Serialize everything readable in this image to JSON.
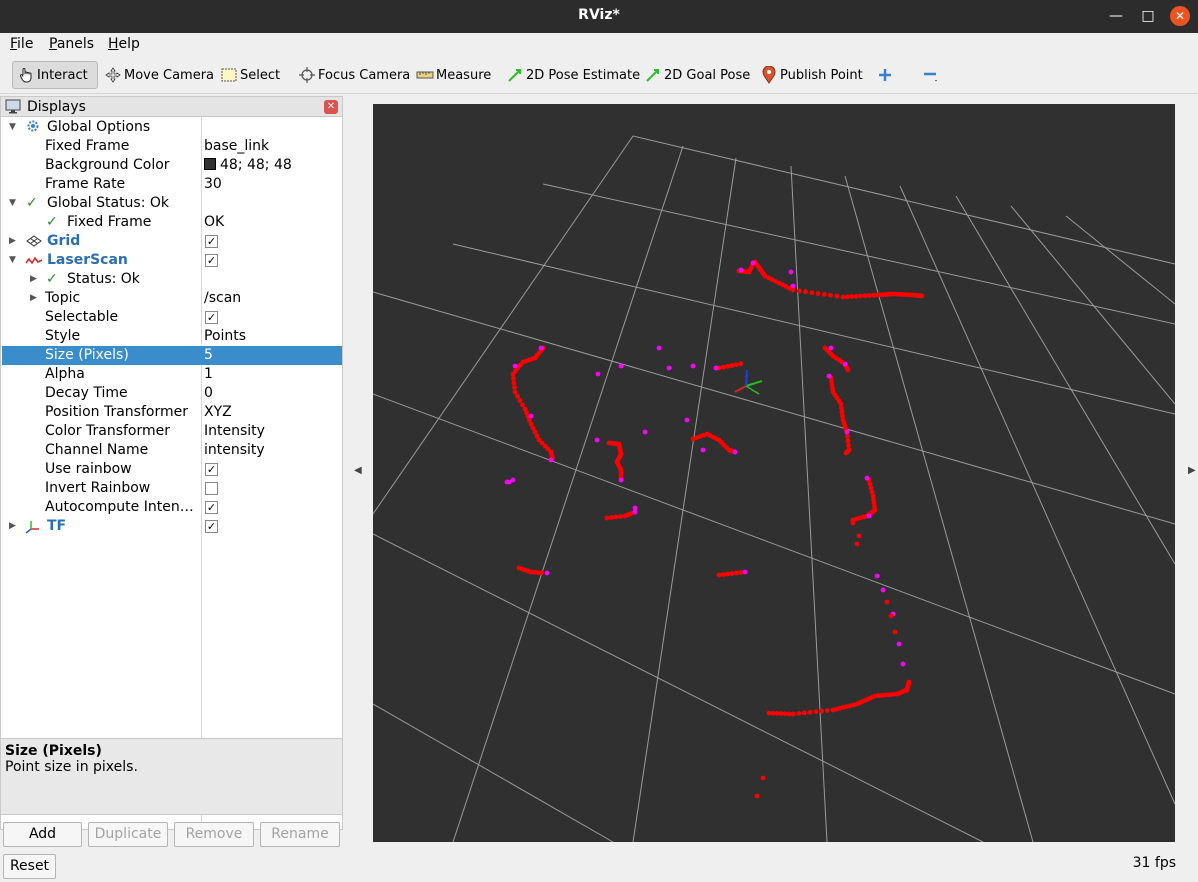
{
  "window": {
    "title": "RViz*"
  },
  "menu": [
    {
      "label": "File",
      "mnemonic": "F",
      "rest": "ile"
    },
    {
      "label": "Panels",
      "mnemonic": "P",
      "rest": "anels"
    },
    {
      "label": "Help",
      "mnemonic": "H",
      "rest": "elp"
    }
  ],
  "toolbar": {
    "interact": "Interact",
    "move_camera": "Move Camera",
    "select": "Select",
    "focus_camera": "Focus Camera",
    "measure": "Measure",
    "pose_estimate": "2D Pose Estimate",
    "goal_pose": "2D Goal Pose",
    "publish_point": "Publish Point"
  },
  "displays": {
    "title": "Displays",
    "global_options": "Global Options",
    "fixed_frame_label": "Fixed Frame",
    "fixed_frame_value": "base_link",
    "background_color_label": "Background Color",
    "background_color_value": "48; 48; 48",
    "frame_rate_label": "Frame Rate",
    "frame_rate_value": "30",
    "global_status": "Global Status: Ok",
    "gs_fixed_frame_label": "Fixed Frame",
    "gs_fixed_frame_value": "OK",
    "grid": "Grid",
    "laserscan": "LaserScan",
    "status_ok": "Status: Ok",
    "topic_label": "Topic",
    "topic_value": "/scan",
    "selectable_label": "Selectable",
    "style_label": "Style",
    "style_value": "Points",
    "size_label": "Size (Pixels)",
    "size_value": "5",
    "alpha_label": "Alpha",
    "alpha_value": "1",
    "decay_label": "Decay Time",
    "decay_value": "0",
    "pos_transformer_label": "Position Transformer",
    "pos_transformer_value": "XYZ",
    "color_transformer_label": "Color Transformer",
    "color_transformer_value": "Intensity",
    "channel_name_label": "Channel Name",
    "channel_name_value": "intensity",
    "use_rainbow_label": "Use rainbow",
    "invert_rainbow_label": "Invert Rainbow",
    "autocompute_label": "Autocompute Inten…",
    "tf": "TF"
  },
  "description": {
    "title": "Size (Pixels)",
    "text": "Point size in pixels."
  },
  "panel_buttons": {
    "add": "Add",
    "duplicate": "Duplicate",
    "remove": "Remove",
    "rename": "Rename",
    "reset": "Reset"
  },
  "status": {
    "fps": "31 fps"
  },
  "colors": {
    "background": "#303030",
    "grid": "#9a9a9a",
    "scan_point": "#ff0000",
    "scan_point_highlight": "#ff00ff",
    "selection": "#3a8ccb"
  },
  "icons": {
    "interact": "hand-pointer-icon",
    "move_camera": "move-camera-icon",
    "select": "select-box-icon",
    "focus_camera": "focus-crosshair-icon",
    "measure": "ruler-icon",
    "pose_estimate": "green-arrow-icon",
    "goal_pose": "green-arrow-icon",
    "publish_point": "map-pin-icon",
    "add_tool": "plus-icon",
    "remove_tool": "minus-icon"
  }
}
